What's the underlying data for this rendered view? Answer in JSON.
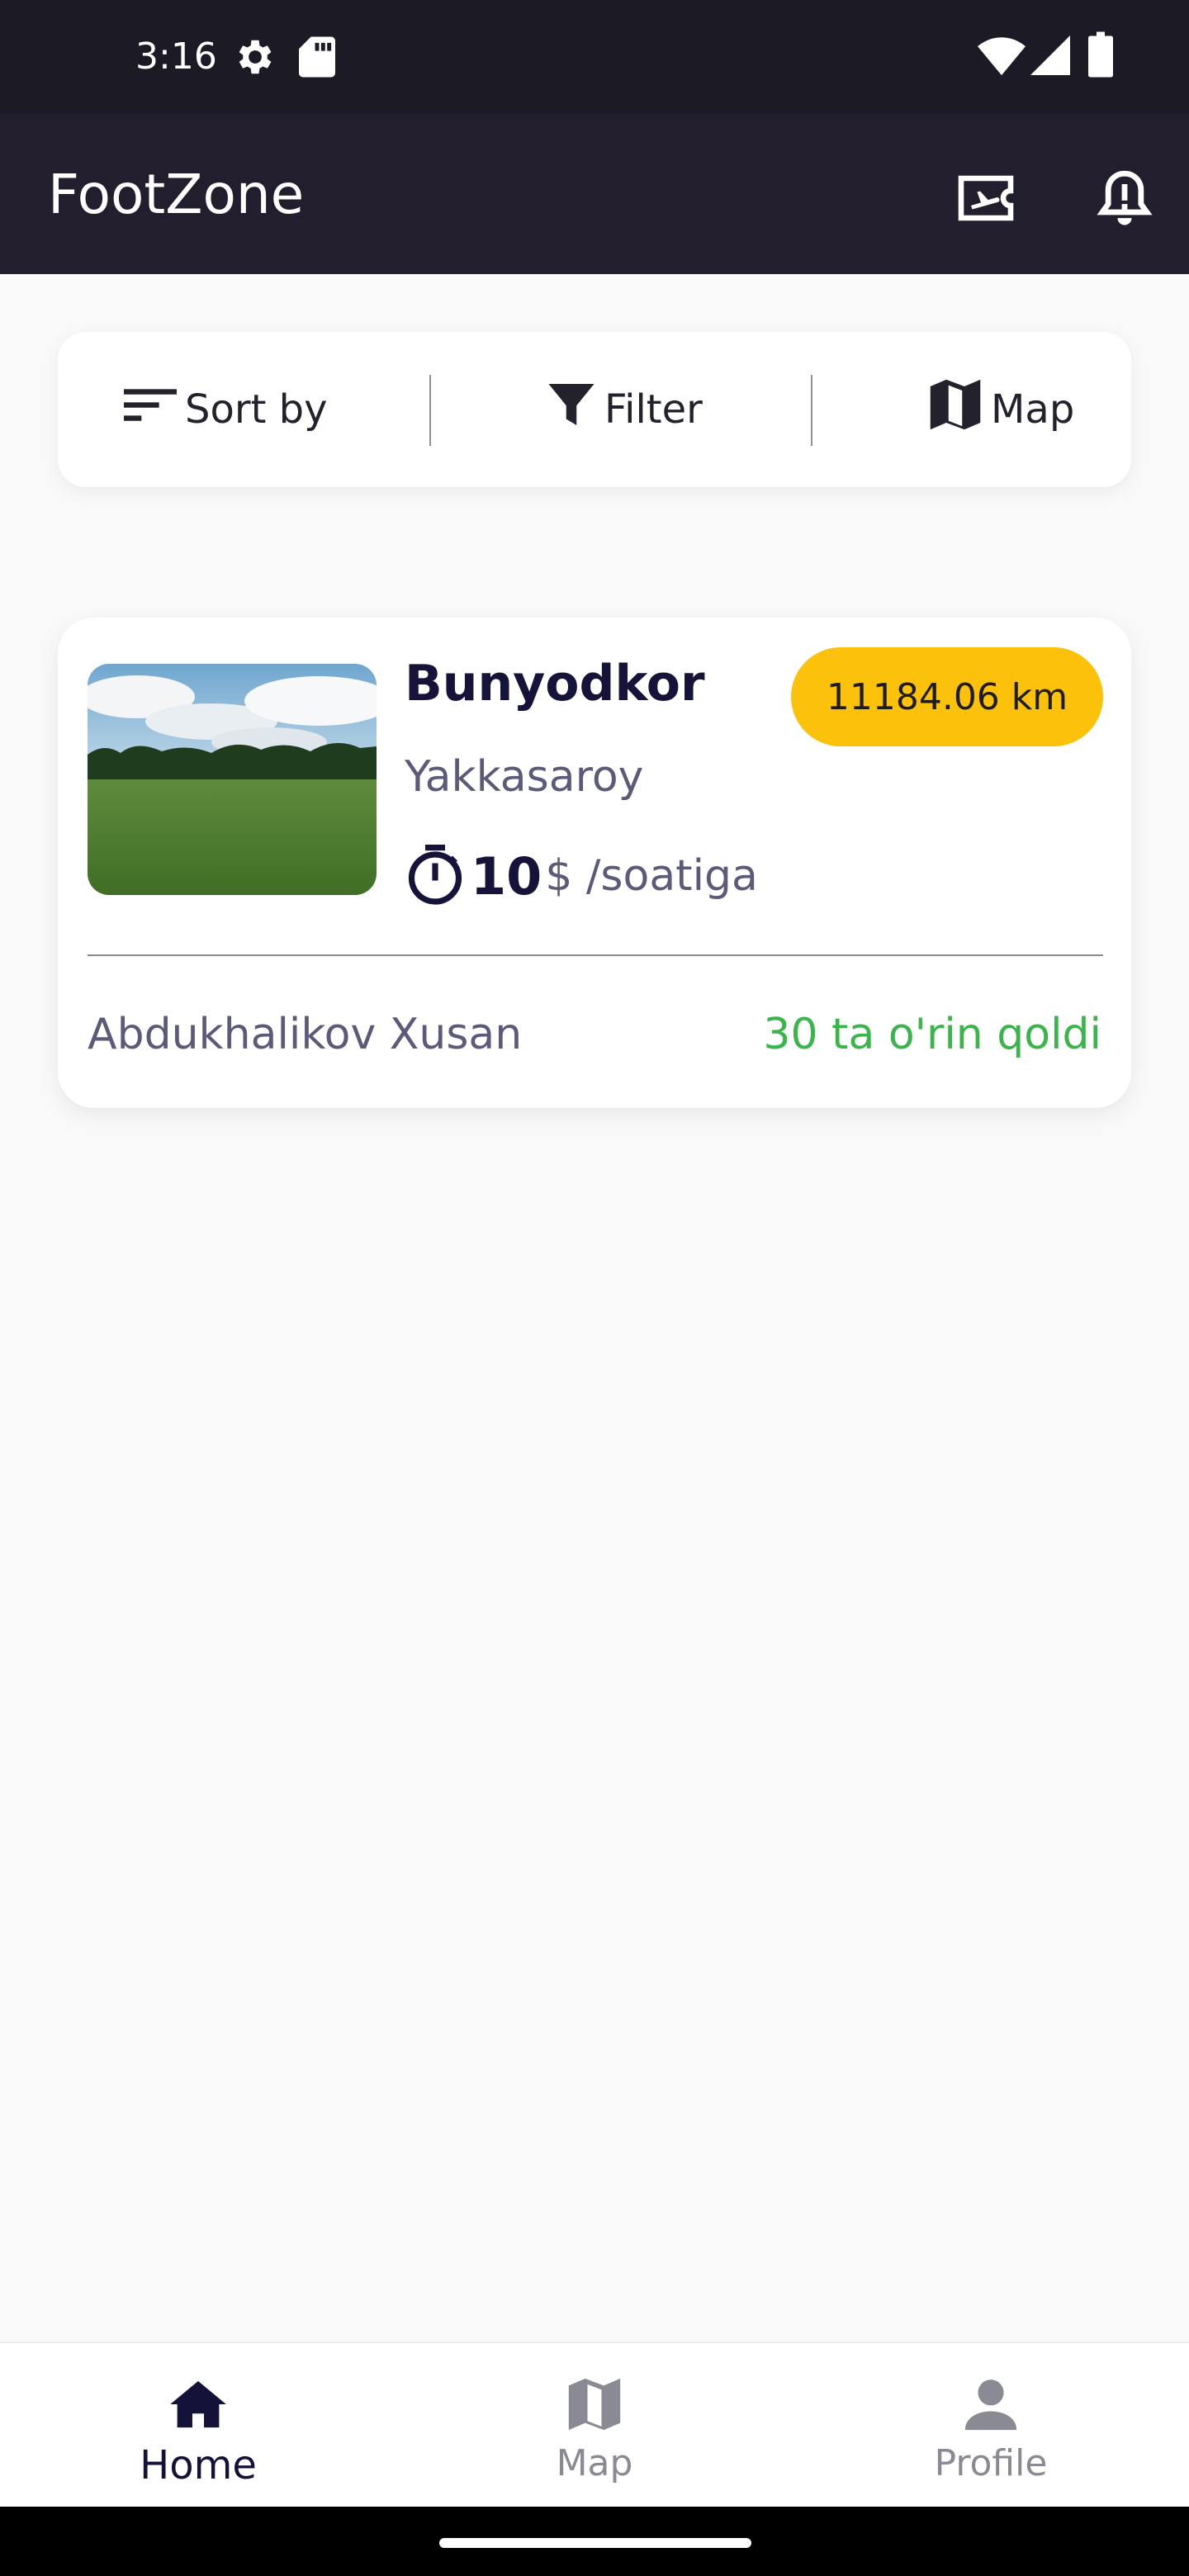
{
  "status_bar": {
    "time": "3:16",
    "icons": [
      "settings-icon",
      "sd-card-icon",
      "wifi-icon",
      "signal-icon",
      "battery-icon"
    ]
  },
  "app_bar": {
    "title": "FootZone",
    "actions": [
      "ticket-icon",
      "notification-alert-icon"
    ]
  },
  "toolbar": {
    "sort_label": "Sort by",
    "filter_label": "Filter",
    "map_label": "Map"
  },
  "stadiums": [
    {
      "name": "Bunyodkor",
      "district": "Yakkasaroy",
      "distance": "11184.06 km",
      "price": "10",
      "price_unit": "$ /soatiga",
      "owner": "Abdukhalikov Xusan",
      "slots_left": "30 ta o'rin qoldi"
    }
  ],
  "bottom_nav": {
    "items": [
      {
        "label": "Home",
        "icon": "home-icon",
        "active": true
      },
      {
        "label": "Map",
        "icon": "map-icon",
        "active": false
      },
      {
        "label": "Profile",
        "icon": "person-icon",
        "active": false
      }
    ]
  },
  "colors": {
    "app_bar": "#231e2e",
    "status_bar": "#1b1a25",
    "badge": "#fcc10a",
    "slots_text": "#39b54a",
    "primary_text": "#15133a",
    "secondary_text": "#5b5a7a"
  }
}
